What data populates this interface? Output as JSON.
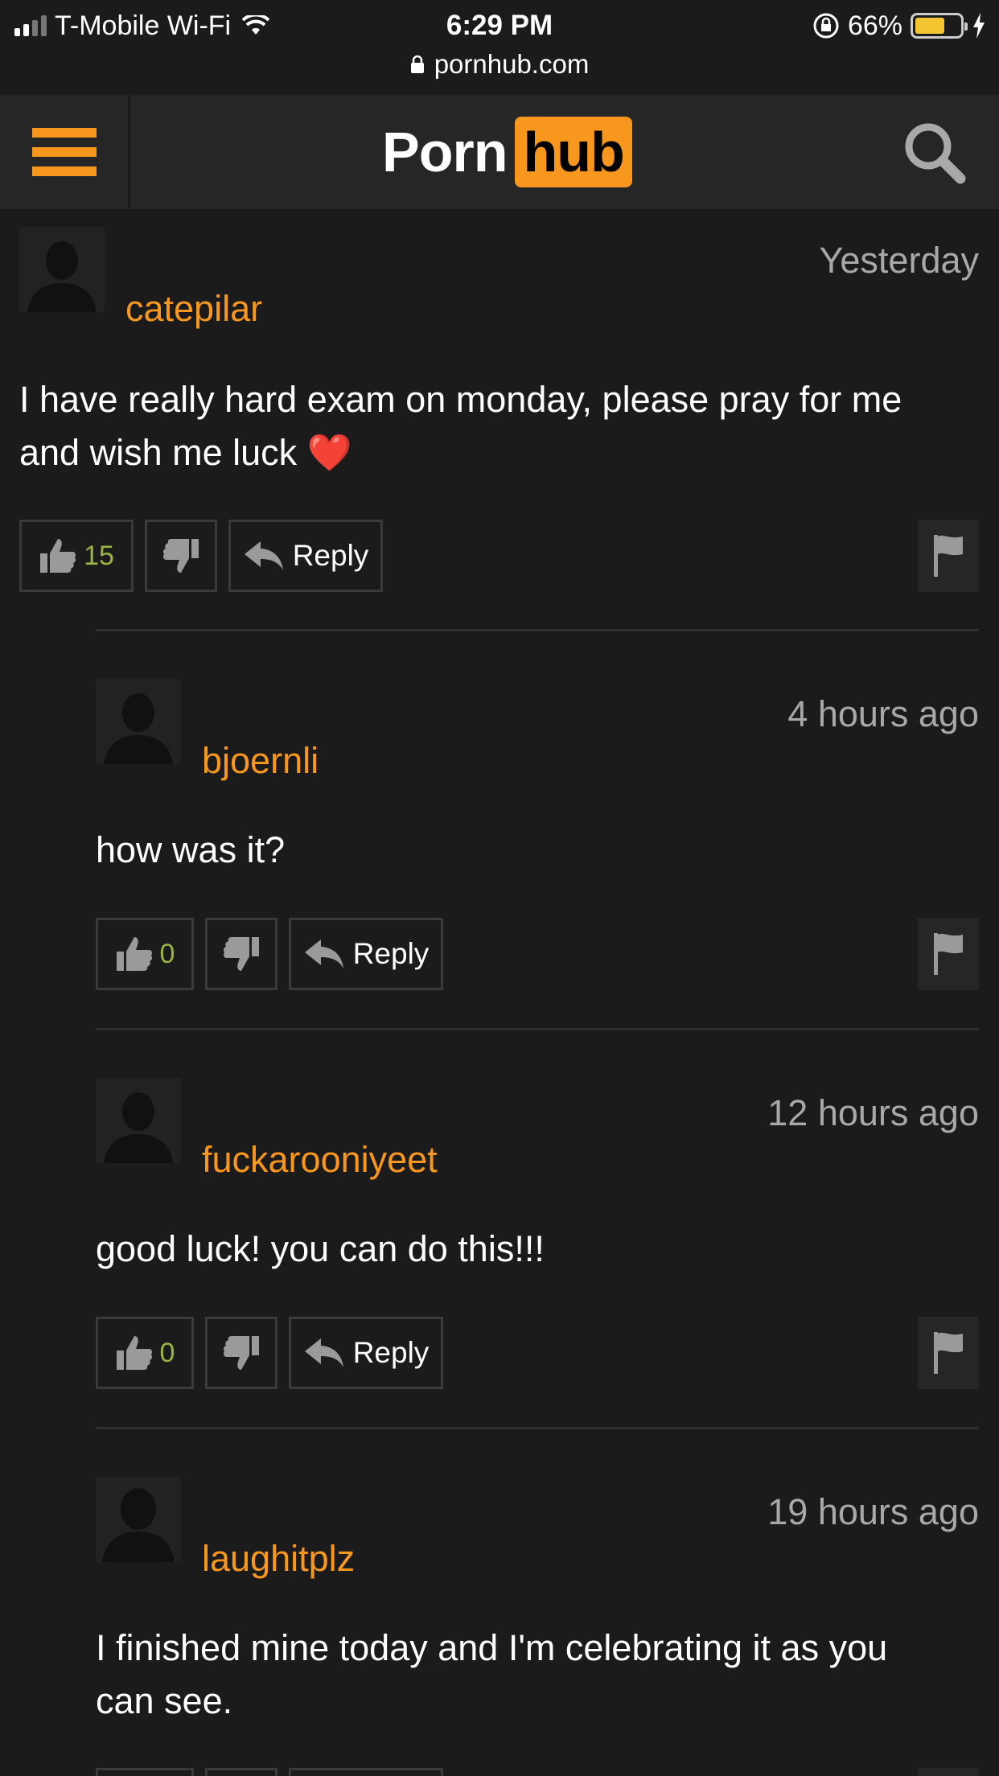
{
  "status_bar": {
    "carrier": "T-Mobile Wi-Fi",
    "time": "6:29 PM",
    "battery": "66%",
    "battery_level": 0.66,
    "url": "pornhub.com"
  },
  "header": {
    "logo_left": "Porn",
    "logo_right": "hub"
  },
  "colors": {
    "accent": "#f7971d",
    "background": "#1b1b1b",
    "like_count": "#9bb544"
  },
  "comments": [
    {
      "username": "catepilar",
      "time": "Yesterday",
      "text_line1": "I have really hard exam on monday, please pray for me",
      "text_line2": "and wish me luck",
      "emoji": "❤️",
      "likes": "15",
      "reply_label": "Reply"
    },
    {
      "username": "bjoernli",
      "time": "4 hours ago",
      "text_line1": "how was it?",
      "likes": "0",
      "reply_label": "Reply"
    },
    {
      "username": "fuckarooniyeet",
      "time": "12 hours ago",
      "text_line1": "good luck! you can do this!!!",
      "likes": "0",
      "reply_label": "Reply"
    },
    {
      "username": "laughitplz",
      "time": "19 hours ago",
      "text_line1": "I finished mine today and I'm celebrating it as you",
      "text_line2": "can see."
    }
  ]
}
